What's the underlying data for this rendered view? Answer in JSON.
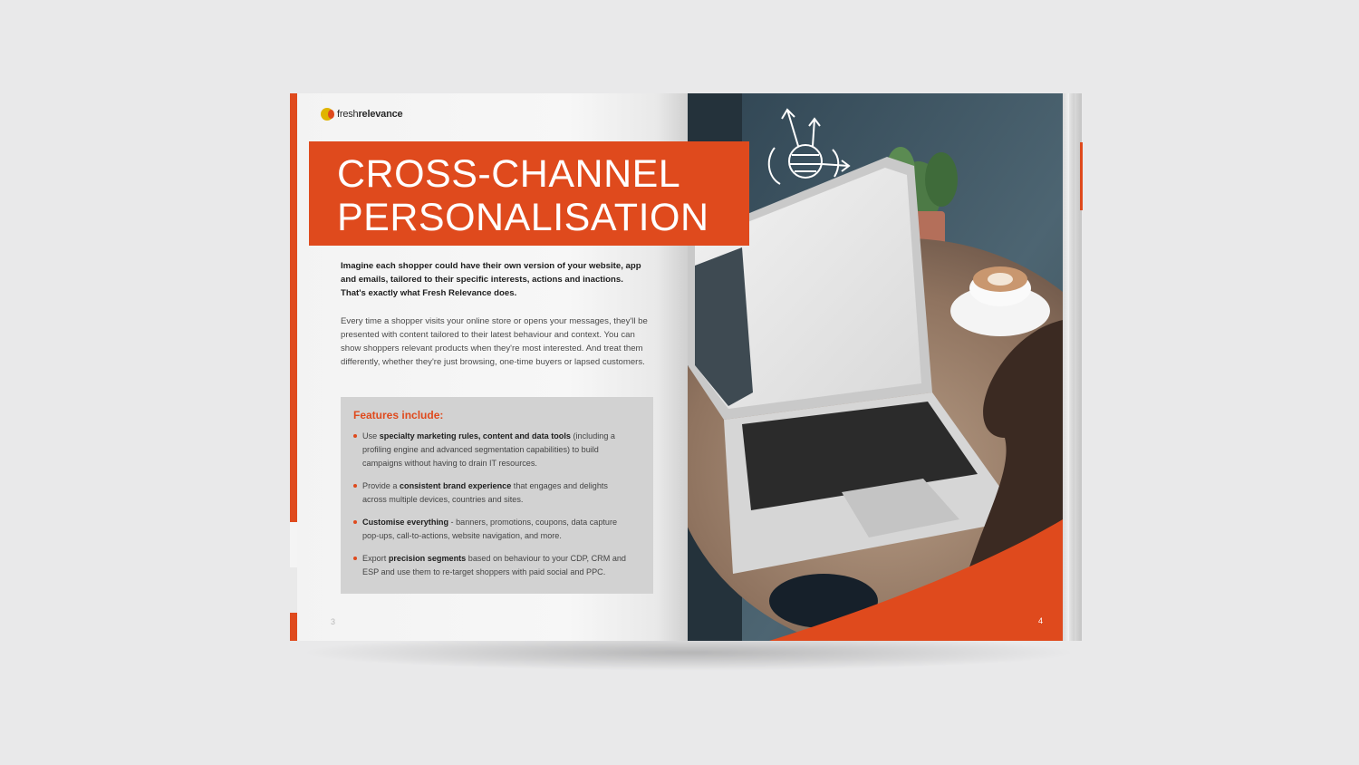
{
  "brand": {
    "logo_light": "fresh",
    "logo_bold": "relevance",
    "accent_color": "#df4a1d",
    "logo_mark_color": "#e0b400"
  },
  "left_page": {
    "title_line1": "CROSS-CHANNEL",
    "title_line2": "PERSONALISATION",
    "intro": "Imagine each shopper could have their own version of your website, app and emails, tailored to their specific interests, actions and inactions. That's exactly what Fresh Relevance does.",
    "body": "Every time a shopper visits your online store or opens your messages, they'll be presented with content tailored to their latest behaviour and context. You can show shoppers relevant products when they're most interested. And treat them differently, whether they're just browsing, one-time buyers or lapsed customers.",
    "features_heading": "Features include:",
    "features": [
      {
        "pre": "Use ",
        "bold": "specialty marketing rules, content and data tools",
        "post": " (including a profiling engine and advanced segmentation capabilities) to build campaigns without having to drain IT resources."
      },
      {
        "pre": "Provide a ",
        "bold": "consistent brand experience",
        "post": " that engages and delights across multiple devices, countries and sites."
      },
      {
        "pre": "",
        "bold": "Customise everything",
        "post": " - banners, promotions, coupons, data capture pop-ups, call-to-actions, website navigation, and more."
      },
      {
        "pre": "Export ",
        "bold": "precision segments",
        "post": " based on behaviour to your CDP, CRM and ESP and use them to re-target shoppers with paid social and PPC."
      }
    ],
    "page_number": "3"
  },
  "right_page": {
    "photo_subject": "laptop-on-cafe-table",
    "illustration_icon": "sphere-arrows-icon",
    "page_number": "4"
  }
}
